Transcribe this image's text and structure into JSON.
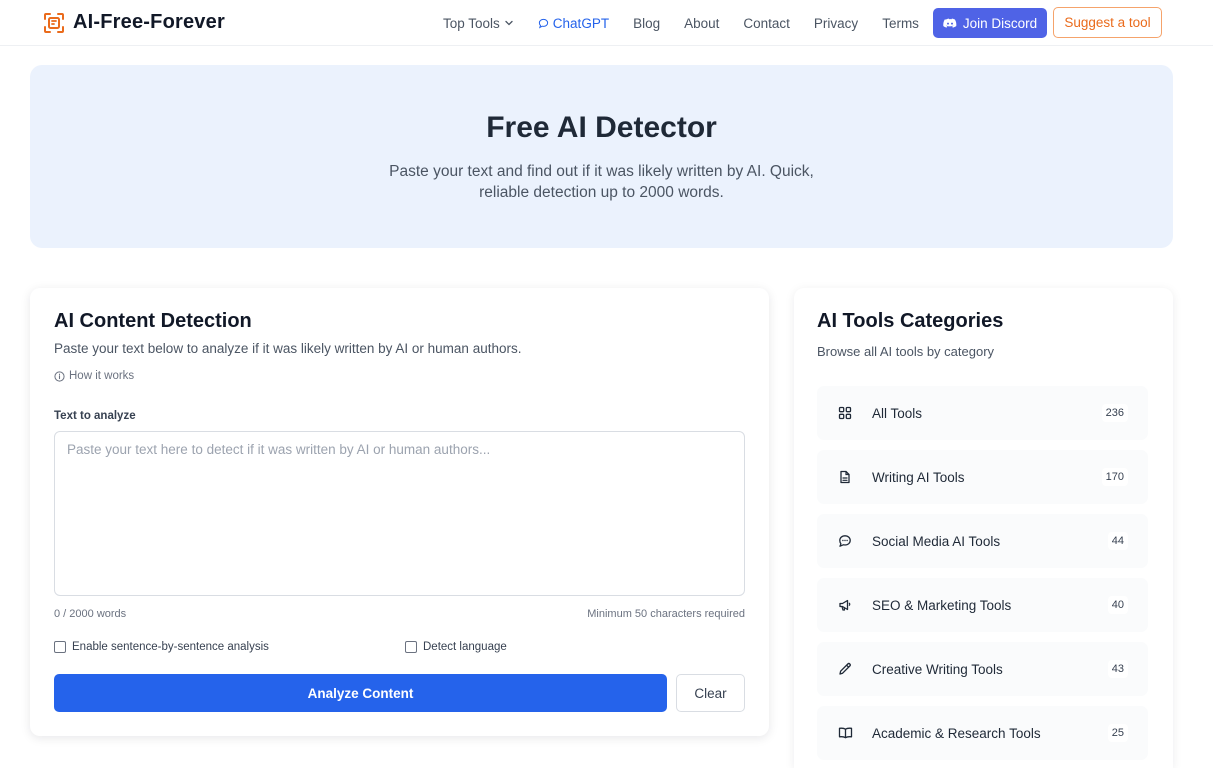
{
  "nav": {
    "logo_text": "AI-Free-Forever",
    "links": [
      {
        "label": "Top Tools"
      },
      {
        "label": "ChatGPT"
      },
      {
        "label": "Blog"
      },
      {
        "label": "About"
      },
      {
        "label": "Contact"
      },
      {
        "label": "Privacy"
      },
      {
        "label": "Terms"
      }
    ],
    "discord_label": "Join Discord",
    "suggest_label": "Suggest a tool"
  },
  "hero": {
    "title": "Free AI Detector",
    "subtitle": "Paste your text and find out if it was likely written by AI. Quick, reliable detection up to 2000 words."
  },
  "detector": {
    "title": "AI Content Detection",
    "subtitle": "Paste your text below to analyze if it was likely written by AI or human authors.",
    "how_label": "How it works",
    "field_label": "Text to analyze",
    "placeholder": "Paste your text here to detect if it was written by AI or human authors...",
    "value": "",
    "word_count": "0 / 2000 words",
    "min_note": "Minimum 50 characters required",
    "option_sentence": "Enable sentence-by-sentence analysis",
    "option_language": "Detect language",
    "analyze_label": "Analyze Content",
    "clear_label": "Clear"
  },
  "sidebar": {
    "title": "AI Tools Categories",
    "subtitle": "Browse all AI tools by category",
    "categories": [
      {
        "label": "All Tools",
        "count": "236",
        "icon": "grid-icon"
      },
      {
        "label": "Writing AI Tools",
        "count": "170",
        "icon": "document-icon"
      },
      {
        "label": "Social Media AI Tools",
        "count": "44",
        "icon": "chat-bubble-icon"
      },
      {
        "label": "SEO & Marketing Tools",
        "count": "40",
        "icon": "megaphone-icon"
      },
      {
        "label": "Creative Writing Tools",
        "count": "43",
        "icon": "pencil-icon"
      },
      {
        "label": "Academic & Research Tools",
        "count": "25",
        "icon": "book-icon"
      }
    ]
  },
  "colors": {
    "primary": "#2563eb",
    "discord": "#4f63e6",
    "accent_orange": "#ea6b1c",
    "hero_bg": "#ebf2fd"
  }
}
